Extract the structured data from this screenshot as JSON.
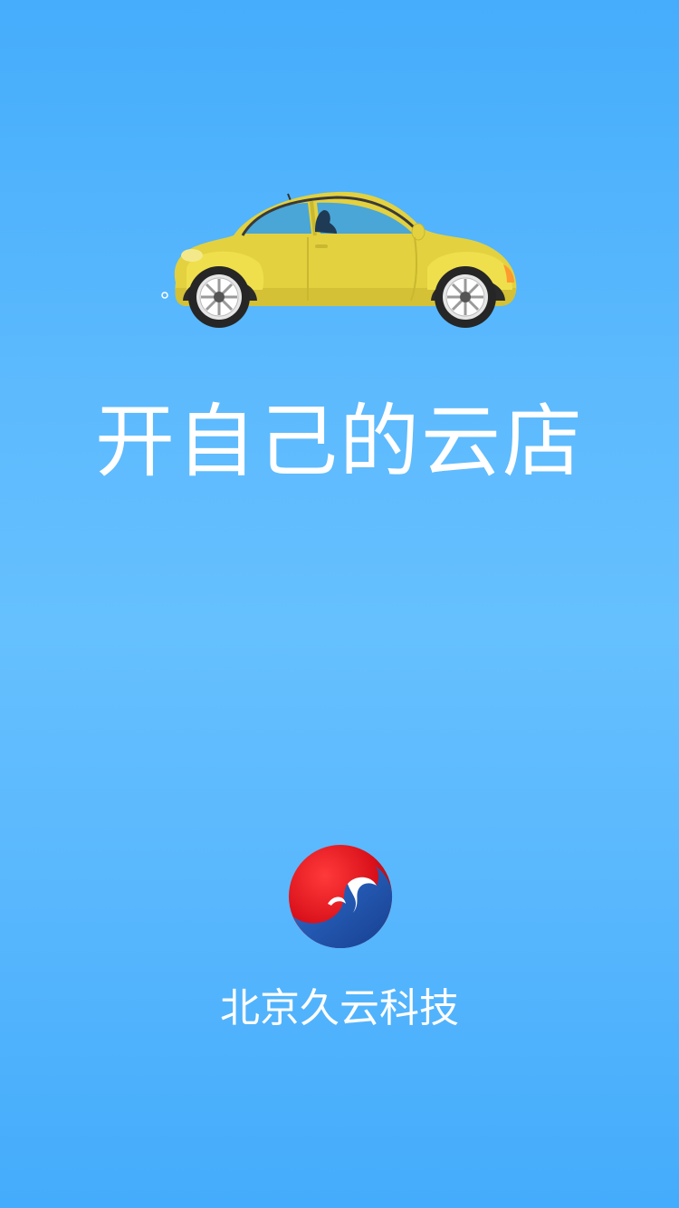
{
  "splash": {
    "slogan": "开自己的云店",
    "company_name": "北京久云科技",
    "illustration": "yellow-car-icon",
    "logo": "company-logo-icon"
  },
  "colors": {
    "background": "#5ab8fd",
    "text": "#ffffff",
    "car_body": "#e3d13f",
    "logo_red": "#e0141e",
    "logo_blue": "#1f56b0"
  }
}
